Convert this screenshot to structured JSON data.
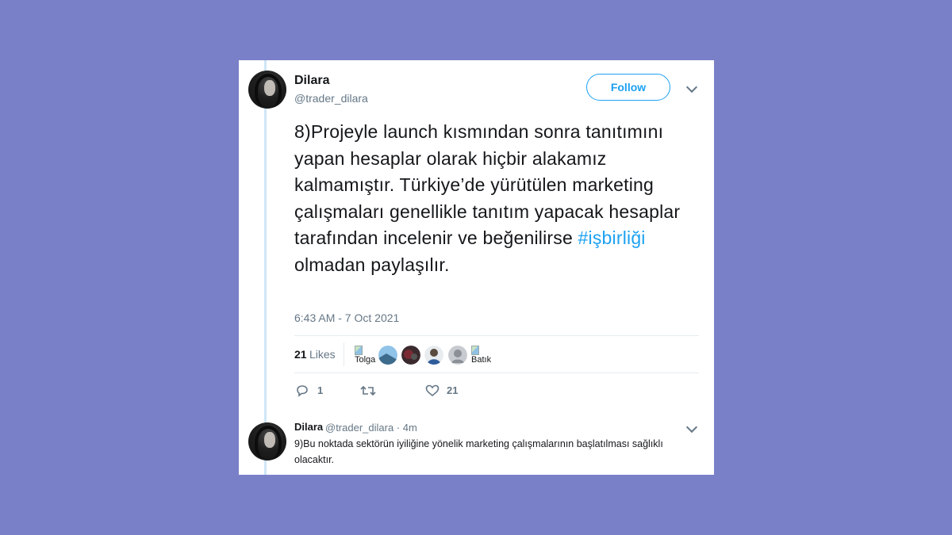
{
  "tweet": {
    "author_name": "Dilara",
    "author_handle": "@trader_dilara",
    "follow_label": "Follow",
    "text_before_hashtag": "8)Projeyle launch kısmından sonra tanıtımını yapan hesaplar olarak hiçbir alakamız kalmamıştır. Türkiye’de yürütülen marketing çalışmaları genellikle tanıtım yapacak hesaplar tarafından incelenir ve beğenilirse ",
    "hashtag": "#işbirliği",
    "text_after_hashtag": " olmadan paylaşılır.",
    "timestamp": "6:43 AM - 7 Oct 2021",
    "likes_count": "21",
    "likes_label": "Likes",
    "likers": [
      {
        "type": "broken",
        "alt": "Tolga"
      },
      {
        "type": "avatar",
        "color": "#8fc3e8"
      },
      {
        "type": "avatar",
        "color": "#7a2a33"
      },
      {
        "type": "avatar",
        "color": "#b0b4ba"
      },
      {
        "type": "avatar",
        "color": "#c7cbd0"
      },
      {
        "type": "broken",
        "alt": "Batık"
      }
    ],
    "actions": {
      "reply_count": "1",
      "retweet_count": "",
      "like_count": "21"
    }
  },
  "reply": {
    "author_name": "Dilara",
    "meta": "@trader_dilara · 4m",
    "text": "9)Bu noktada sektörün iyiliğine yönelik marketing çalışmalarının başlatılması sağlıklı olacaktır."
  },
  "colors": {
    "background": "#7a80c8",
    "accent": "#1da1f2",
    "secondary_text": "#657786"
  }
}
